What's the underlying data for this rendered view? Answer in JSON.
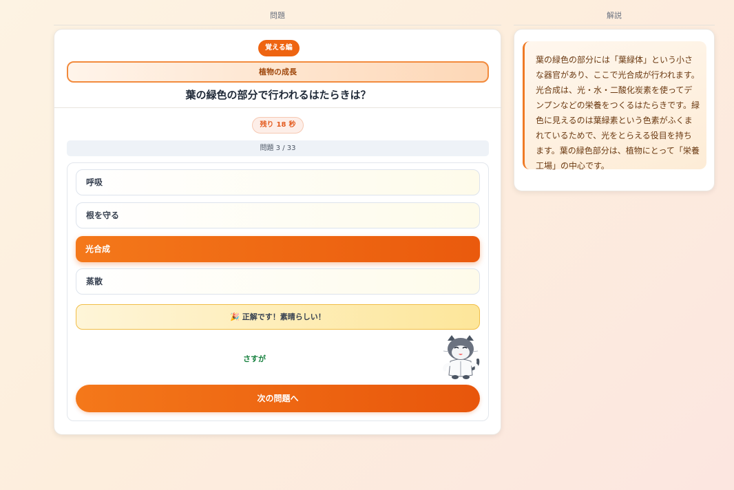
{
  "columns": {
    "question": "問題",
    "explanation": "解説"
  },
  "quiz": {
    "mode_badge": "覚える編",
    "topic": "植物の成長",
    "question": "葉の緑色の部分で行われるはたらきは？",
    "timer": {
      "prefix": "残り",
      "seconds": "18",
      "unit": "秒"
    },
    "progress": "問題 3 / 33",
    "options": [
      {
        "label": "呼吸",
        "selected": false
      },
      {
        "label": "根を守る",
        "selected": false
      },
      {
        "label": "光合成",
        "selected": true
      },
      {
        "label": "蒸散",
        "selected": false
      }
    ],
    "feedback": {
      "icon": "🎉",
      "text": "正解です！素晴らしい！"
    },
    "mascot_comment": "さすが",
    "next_button": "次の問題へ"
  },
  "explanation": {
    "text": "葉の緑色の部分には「葉緑体」という小さな器官があり、ここで光合成が行われます。光合成は、光・水・二酸化炭素を使ってデンプンなどの栄養をつくるはたらきです。緑色に見えるのは葉緑素という色素がふくまれているためで、光をとらえる役目を持ちます。葉の緑色部分は、植物にとって「栄養工場」の中心です。"
  },
  "colors": {
    "accent": "#ee6411",
    "success": "#15803d",
    "feedback_bg": "#fde69a"
  }
}
